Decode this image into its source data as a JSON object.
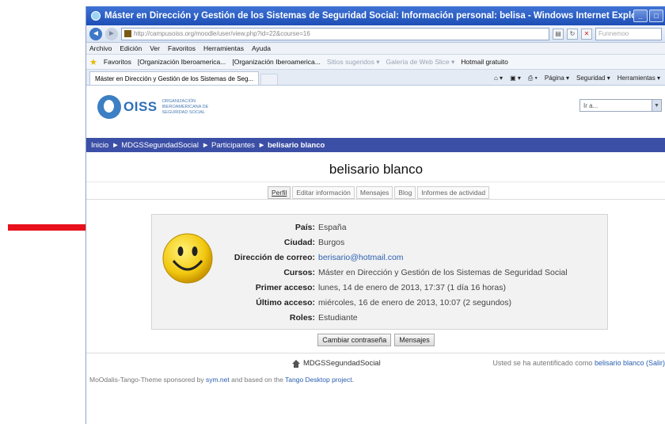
{
  "browser": {
    "title": "Máster en Dirección y Gestión de los Sistemas de Seguridad Social: Información personal: belisa - Windows Internet Explorer",
    "address": "http://campusoiss.org/moodle/user/view.php?id=22&course=16",
    "search_placeholder": "Funnemoo",
    "menu": [
      "Archivo",
      "Edición",
      "Ver",
      "Favoritos",
      "Herramientas",
      "Ayuda"
    ],
    "favorites_label": "Favoritos",
    "favorites": [
      "[Organización Iberoamerica...",
      "[Organización Iberoamerica...",
      "Sitios sugeridos ▾",
      "Galería de Web Slice ▾",
      "Hotmail gratuito"
    ],
    "tab_label": "Máster en Dirección y Gestión de los Sistemas de Seg...",
    "commands": [
      "Página ▾",
      "Seguridad ▾",
      "Herramientas ▾"
    ],
    "window_buttons": [
      "_",
      "□"
    ]
  },
  "site": {
    "logo_text": "OISS",
    "logo_sub": "ORGANIZACIÓN IBEROAMERICANA DE SEGURIDAD SOCIAL",
    "jump_placeholder": "Ir a...",
    "breadcrumb": [
      "Inicio",
      "► MDGSSegundadSocial",
      "► Participantes",
      "► belisario blanco"
    ]
  },
  "profile": {
    "name": "belisario blanco",
    "tabs": [
      "Perfil",
      "Editar información",
      "Mensajes",
      "Blog",
      "Informes de actividad"
    ],
    "fields": [
      {
        "label": "País:",
        "value": "España",
        "link": false
      },
      {
        "label": "Ciudad:",
        "value": "Burgos",
        "link": false
      },
      {
        "label": "Dirección de correo:",
        "value": "berisario@hotmail.com",
        "link": true
      },
      {
        "label": "Cursos:",
        "value": "Máster en Dirección y Gestión de los Sistemas de Seguridad Social",
        "link": false
      },
      {
        "label": "Primer acceso:",
        "value": "lunes, 14 de enero de 2013, 17:37  (1 día 16 horas)",
        "link": false
      },
      {
        "label": "Último acceso:",
        "value": "miércoles, 16 de enero de 2013, 10:07  (2 segundos)",
        "link": false
      },
      {
        "label": "Roles:",
        "value": "Estudiante",
        "link": false
      }
    ],
    "buttons": [
      "Cambiar contraseña",
      "Mensajes"
    ]
  },
  "footer": {
    "home_label": "MDGSSegundadSocial",
    "login_prefix": "Usted se ha autentificado como",
    "login_user": "belisario blanco",
    "logout": "(Salir)",
    "credits_prefix": "MoOdalis-Tango-Theme sponsored by",
    "credits_link1": "sym.net",
    "credits_middle": "and based on the",
    "credits_link2": "Tango Desktop project."
  },
  "annotation": {
    "arrow_color": "#e8101a"
  }
}
